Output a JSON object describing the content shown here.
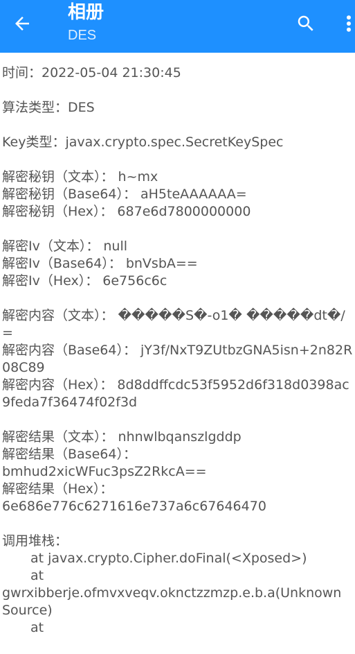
{
  "appbar": {
    "title": "相册",
    "subtitle": "DES",
    "back_icon": "arrow-left-icon",
    "search_icon": "search-icon",
    "more_icon": "more-vertical-icon",
    "background": "#1e90ff"
  },
  "content": {
    "time": "时间：2022-05-04 21:30:45",
    "algorithm": "算法类型：DES",
    "key_type": "Key类型：javax.crypto.spec.SecretKeySpec",
    "key_text": "解密秘钥（文本）： h~mx",
    "key_base64": "解密秘钥（Base64）： aH5teAAAAAA=",
    "key_hex": "解密秘钥（Hex）： 687e6d7800000000",
    "iv_text": "解密Iv（文本）： null",
    "iv_base64": "解密Iv（Base64）： bnVsbA==",
    "iv_hex": "解密Iv（Hex）： 6e756c6c",
    "content_text": "解密内容（文本）： �����S�-o1� �����dt�/=",
    "content_base64": "解密内容（Base64）： jY3f/NxT9ZUtbzGNA5isn+2n82R08C89",
    "content_hex": "解密内容（Hex）： 8d8ddffcdc53f5952d6f318d0398ac9feda7f36474f02f3d",
    "result_text": "解密结果（文本）： nhnwlbqanszlgddp",
    "result_base64_label": "解密结果（Base64）：",
    "result_base64_value": "bmhud2xicWFuc3psZ2RkcA==",
    "result_hex_label": "解密结果（Hex）：",
    "result_hex_value": "6e686e776c6271616e737a6c67646470",
    "stack_label": "调用堆栈：",
    "stack_lines": [
      "at javax.crypto.Cipher.doFinal(<Xposed>)",
      "at",
      "gwrxibberje.ofmvxveqv.oknctzzmzp.e.b.a(Unknown Source)",
      "at"
    ]
  }
}
